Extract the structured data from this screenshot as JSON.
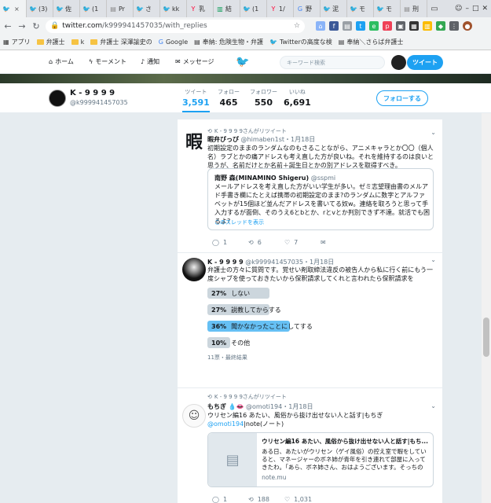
{
  "browser": {
    "tabs": [
      {
        "label": "",
        "icon": "twitter-icon",
        "color": "#1da1f2",
        "active": true
      },
      {
        "label": "(3)",
        "icon": "twitter-icon",
        "color": "#1da1f2"
      },
      {
        "label": "佐",
        "icon": "twitter-icon",
        "color": "#1da1f2"
      },
      {
        "label": "(1",
        "icon": "twitter-icon",
        "color": "#1da1f2"
      },
      {
        "label": "Pr",
        "icon": "page-icon",
        "color": "#888888"
      },
      {
        "label": "さ",
        "icon": "twitter-icon",
        "color": "#1da1f2"
      },
      {
        "label": "kk",
        "icon": "twitter-icon",
        "color": "#1da1f2"
      },
      {
        "label": "乳",
        "icon": "yahoo-icon",
        "color": "#ff0033"
      },
      {
        "label": "結",
        "icon": "doc-icon",
        "color": "#0f9d58"
      },
      {
        "label": "(1",
        "icon": "twitter-icon",
        "color": "#1da1f2"
      },
      {
        "label": "1/",
        "icon": "yahoo-icon",
        "color": "#ff0033"
      },
      {
        "label": "野",
        "icon": "google-icon",
        "color": "#4285f4"
      },
      {
        "label": "泥",
        "icon": "twitter-icon",
        "color": "#1da1f2"
      },
      {
        "label": "モ",
        "icon": "twitter-icon",
        "color": "#1da1f2"
      },
      {
        "label": "モ",
        "icon": "twitter-icon",
        "color": "#1da1f2"
      },
      {
        "label": "刑",
        "icon": "page-icon",
        "color": "#888888"
      }
    ],
    "close_glyph": "×",
    "url_host": "twitter.com",
    "url_path": "/k999941457035/with_replies",
    "bookmarks": [
      {
        "label": "アプリ",
        "icon": "apps-icon"
      },
      {
        "label": "弁護士",
        "icon": "folder-icon"
      },
      {
        "label": "k",
        "icon": "folder-icon"
      },
      {
        "label": "弁護士 深澤諭史の",
        "icon": "folder-icon"
      },
      {
        "label": "Google",
        "icon": "google-icon"
      },
      {
        "label": "奉納: 危険生物・弁護",
        "icon": "page-icon"
      },
      {
        "label": "Twitterの高度な検",
        "icon": "twitter-icon"
      },
      {
        "label": "奉納＼さらば弁護士",
        "icon": "page-icon"
      }
    ]
  },
  "twitter_nav": {
    "home": "ホーム",
    "moments": "モーメント",
    "notifications": "通知",
    "messages": "メッセージ",
    "search_placeholder": "キーワード検索",
    "tweet_button": "ツイート"
  },
  "profile": {
    "name": "K - 9 9 9 9",
    "handle": "@k999941457035",
    "stats": [
      {
        "label": "ツイート",
        "value": "3,591",
        "active": true
      },
      {
        "label": "フォロー",
        "value": "465"
      },
      {
        "label": "フォロワー",
        "value": "550"
      },
      {
        "label": "いいね",
        "value": "6,691"
      }
    ],
    "follow_button": "フォローする"
  },
  "tweets": {
    "t1": {
      "retweet_line": "K - 9 9 9 9さんがリツイート",
      "name": "暇弁びっび",
      "handle": "@himaben1st",
      "date": "・1月18日",
      "avatar_char": "暇",
      "text": "初期設定のままのランダムなのもさることながら、アニメキャラとか〇〇（個人名）ラブとかの痛アドレスも考え直した方が良いね。それを維持するのは良いと思うが、名前だけとか名前＋誕生日とかの別アドレスを取得すべき。",
      "quote_name": "南野 森(MINAMINO Shigeru)",
      "quote_handle": "@sspmi",
      "quote_text": "メールアドレスを考え直した方がいい学生が多い。ゼミ志望理由書のメルアド手書き欄にたとえば携帯の初期設定のまま?のランダムに数字とアルファベットが15個ほど並んだアドレスを書いてる奴w。連絡を取ろうと思って手入力するが面倒、そのうえ6とbとか、rとvとか判別できず不達。就活でも困るよ?",
      "quote_thread": "このスレッドを表示",
      "replies": "1",
      "retweets": "6",
      "likes": "7"
    },
    "t2": {
      "name": "K - 9 9 9 9",
      "handle": "@k999941457035",
      "date": "・1月18日",
      "text": "弁護士の方々に質問です。覚せい剤取締法違反の被告人から私に行く前にもう一度シャブを使っておきたいから保釈請求してくれと言われたら保釈請求を",
      "poll": [
        {
          "pct": "27%",
          "label": "しない",
          "value": 27
        },
        {
          "pct": "27%",
          "label": "説教してからする",
          "value": 27
        },
        {
          "pct": "36%",
          "label": "聞かなかったことにしてする",
          "value": 36,
          "winner": true
        },
        {
          "pct": "10%",
          "label": "その他",
          "value": 10
        }
      ],
      "poll_footer": "11票・最終結果"
    },
    "t3": {
      "retweet_line": "K - 9 9 9 9さんがリツイート",
      "name": "もちぎ",
      "handle": "@omoti194",
      "date": "・1月18日",
      "text_prefix": "ウリセン編16 あたい、風俗から抜け出せない人と話す|もちぎ ",
      "text_link": "@omoti194",
      "text_suffix": "|note(ノート)",
      "card_title": "ウリセン編16 あたい、風俗から抜け出せない人と話す|もち...",
      "card_text": "ある日、あたいがウリセン（ゲイ風俗）の控え室で暇をしていると、マネージャーのボネ姉が青年を引き連れて部屋に入ってきたわ。「あら、ボネ姉さん、おはようございます。そっちの男...",
      "card_domain": "note.mu",
      "replies": "1",
      "retweets": "188",
      "likes": "1,031"
    }
  },
  "colors": {
    "accent": "#1da1f2",
    "poll_winner": "#66c0f4"
  }
}
